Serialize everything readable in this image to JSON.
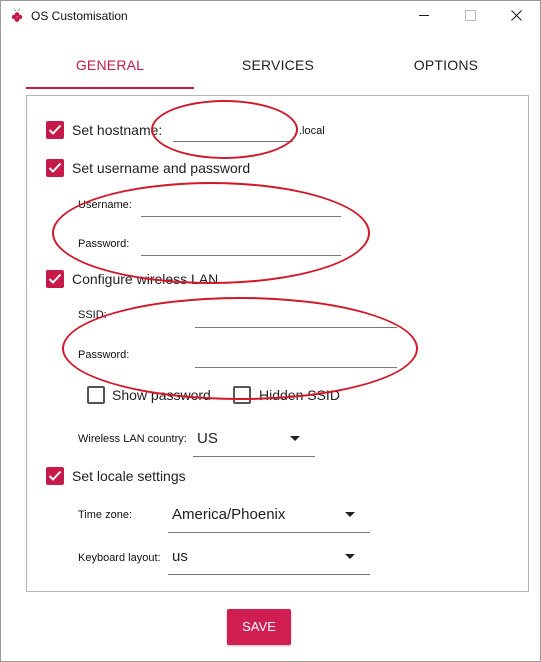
{
  "window": {
    "title": "OS Customisation",
    "accent": "#c51a4a",
    "annotation_color": "#d1182a"
  },
  "titlebar": {
    "minimize_icon": "minimize-icon",
    "maximize_icon": "maximize-icon",
    "close_icon": "close-icon"
  },
  "tabs": [
    {
      "label": "GENERAL",
      "active": true
    },
    {
      "label": "SERVICES",
      "active": false
    },
    {
      "label": "OPTIONS",
      "active": false
    }
  ],
  "general": {
    "hostname": {
      "label": "Set hostname:",
      "checked": true,
      "value": "",
      "suffix": ".local"
    },
    "credentials": {
      "label": "Set username and password",
      "checked": true,
      "username_label": "Username:",
      "username_value": "",
      "password_label": "Password:",
      "password_value": ""
    },
    "wireless": {
      "label": "Configure wireless LAN",
      "checked": true,
      "ssid_label": "SSID:",
      "ssid_value": "",
      "password_label": "Password:",
      "password_value": "",
      "show_password": {
        "label": "Show password",
        "checked": false
      },
      "hidden_ssid": {
        "label": "Hidden SSID",
        "checked": false
      },
      "country_label": "Wireless LAN country:",
      "country_value": "US"
    },
    "locale": {
      "label": "Set locale settings",
      "checked": true,
      "timezone_label": "Time zone:",
      "timezone_value": "America/Phoenix",
      "keyboard_label": "Keyboard layout:",
      "keyboard_value": "us"
    }
  },
  "save_label": "SAVE"
}
